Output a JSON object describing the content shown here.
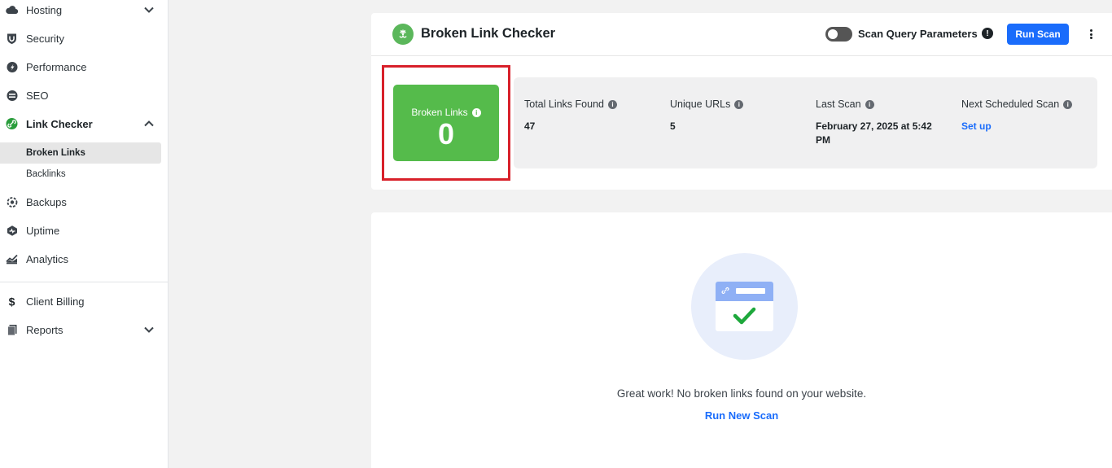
{
  "sidebar": {
    "items": [
      {
        "label": "Hosting",
        "icon": "cloud-icon"
      },
      {
        "label": "Security",
        "icon": "shield-icon"
      },
      {
        "label": "Performance",
        "icon": "gauge-icon"
      },
      {
        "label": "SEO",
        "icon": "seo-icon"
      },
      {
        "label": "Link Checker",
        "icon": "link-checker-icon"
      },
      {
        "label": "Backups",
        "icon": "backups-icon"
      },
      {
        "label": "Uptime",
        "icon": "uptime-icon"
      },
      {
        "label": "Analytics",
        "icon": "analytics-icon"
      },
      {
        "label": "Client Billing",
        "icon": "dollar-icon"
      },
      {
        "label": "Reports",
        "icon": "reports-icon"
      }
    ],
    "link_checker_sub": [
      {
        "label": "Broken Links",
        "active": true
      },
      {
        "label": "Backlinks",
        "active": false
      }
    ]
  },
  "header": {
    "title": "Broken Link Checker",
    "toggle_label": "Scan Query Parameters",
    "toggle_on": false,
    "run_scan_label": "Run Scan"
  },
  "summary": {
    "broken_label": "Broken Links",
    "broken_count": "0",
    "stats": [
      {
        "label": "Total Links Found",
        "value": "47"
      },
      {
        "label": "Unique URLs",
        "value": "5"
      },
      {
        "label": "Last Scan",
        "value": "February 27, 2025 at 5:42 PM"
      },
      {
        "label": "Next Scheduled Scan",
        "value": "Set up"
      }
    ]
  },
  "empty_state": {
    "message": "Great work! No broken links found on your website.",
    "action_label": "Run New Scan"
  },
  "colors": {
    "accent": "#1a6cfb",
    "success": "#55bb4b",
    "highlight": "#d8202a"
  }
}
